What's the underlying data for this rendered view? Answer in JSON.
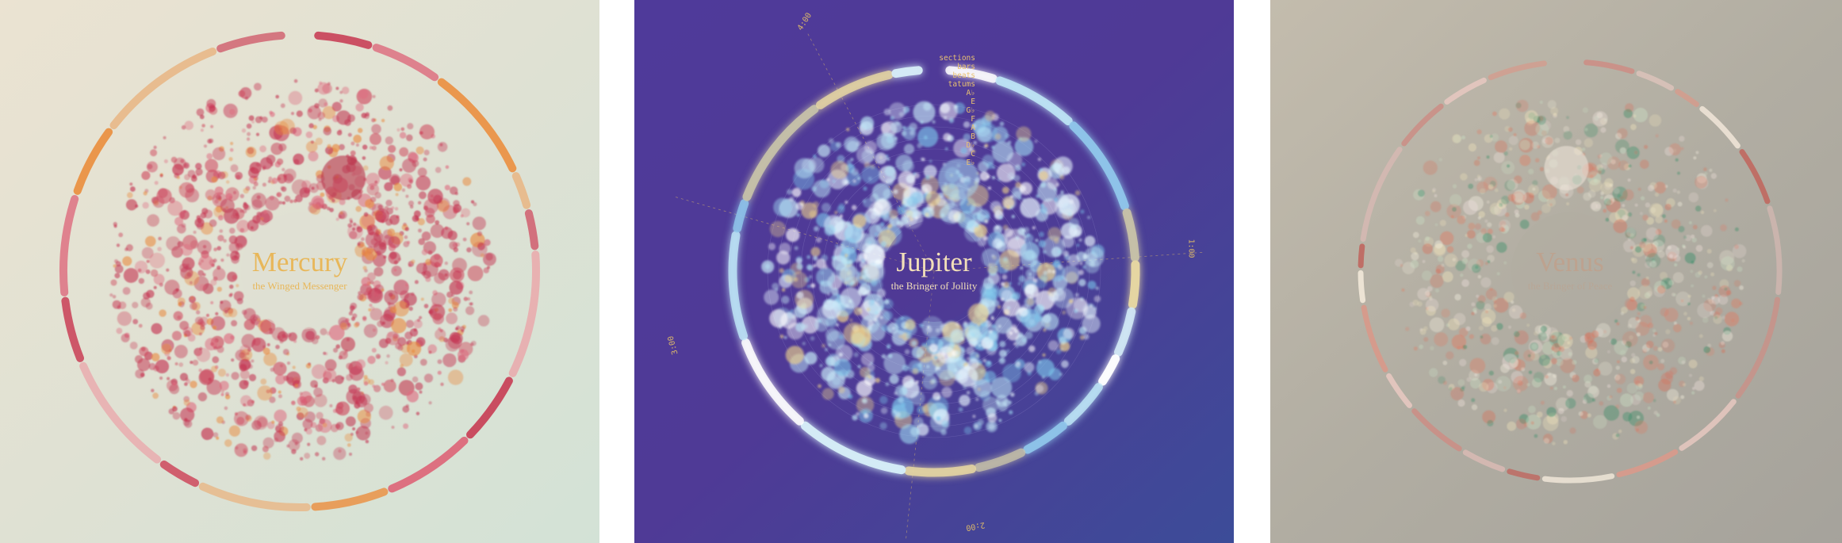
{
  "panels": [
    {
      "id": "mercury",
      "title": "Mercury",
      "subtitle": "the Winged Messenger",
      "background": [
        "#ebe3d2",
        "#dfe1d3",
        "#d3e2d6"
      ],
      "title_color": "#e8b75a",
      "palette": [
        "#c4314f",
        "#c4314f",
        "#c4314f",
        "#cf4c61",
        "#de6b7f",
        "#e98a3e",
        "#c23a55"
      ],
      "ring_palette": [
        "#c6304a",
        "#dd6478",
        "#ea9448",
        "#e7b98a",
        "#cf5566",
        "#eaa6a9"
      ],
      "highlight_color": "#b8304a"
    },
    {
      "id": "jupiter",
      "title": "Jupiter",
      "subtitle": "the Bringer of Jollity",
      "background": [
        "#4f3a9a",
        "#4f3a96",
        "#3c4c98"
      ],
      "title_color": "#f2dfb9",
      "palette": [
        "#c8ecf8",
        "#9fd9f2",
        "#7cc4ea",
        "#ffffff",
        "#e9f7ff",
        "#eed28c",
        "#b9e3f4"
      ],
      "ring_palette": [
        "#ffffff",
        "#bfe7f7",
        "#8fc5ea",
        "#c8c3a8",
        "#e6d6a2",
        "#d5ecf7"
      ],
      "highlight_color": "#a7d6ef",
      "legend_title": "sections",
      "legend_items": [
        "bars",
        "beats",
        "tatums",
        "A♭",
        "E",
        "G♭",
        "F",
        "A",
        "B",
        "D♭",
        "C",
        "E♭"
      ],
      "axis_labels": [
        "4:00",
        "1:00",
        "2:00",
        "3:00"
      ]
    },
    {
      "id": "venus",
      "title": "Venus",
      "subtitle": "the Bringer of Peace",
      "background": [
        "#c3bcad",
        "#b1ada2",
        "#a5a29b"
      ],
      "title_color": "#c69a80",
      "palette": [
        "#f1e4bc",
        "#f6f1e1",
        "#e3785f",
        "#2f8b63",
        "#efe0dc",
        "#d86e58",
        "#cbe2c6"
      ],
      "ring_palette": [
        "#cb8f86",
        "#e1c5bd",
        "#d69b8c",
        "#efe5d7",
        "#bf6a62",
        "#d3b8b1"
      ],
      "highlight_color": "#ede3d8"
    }
  ]
}
